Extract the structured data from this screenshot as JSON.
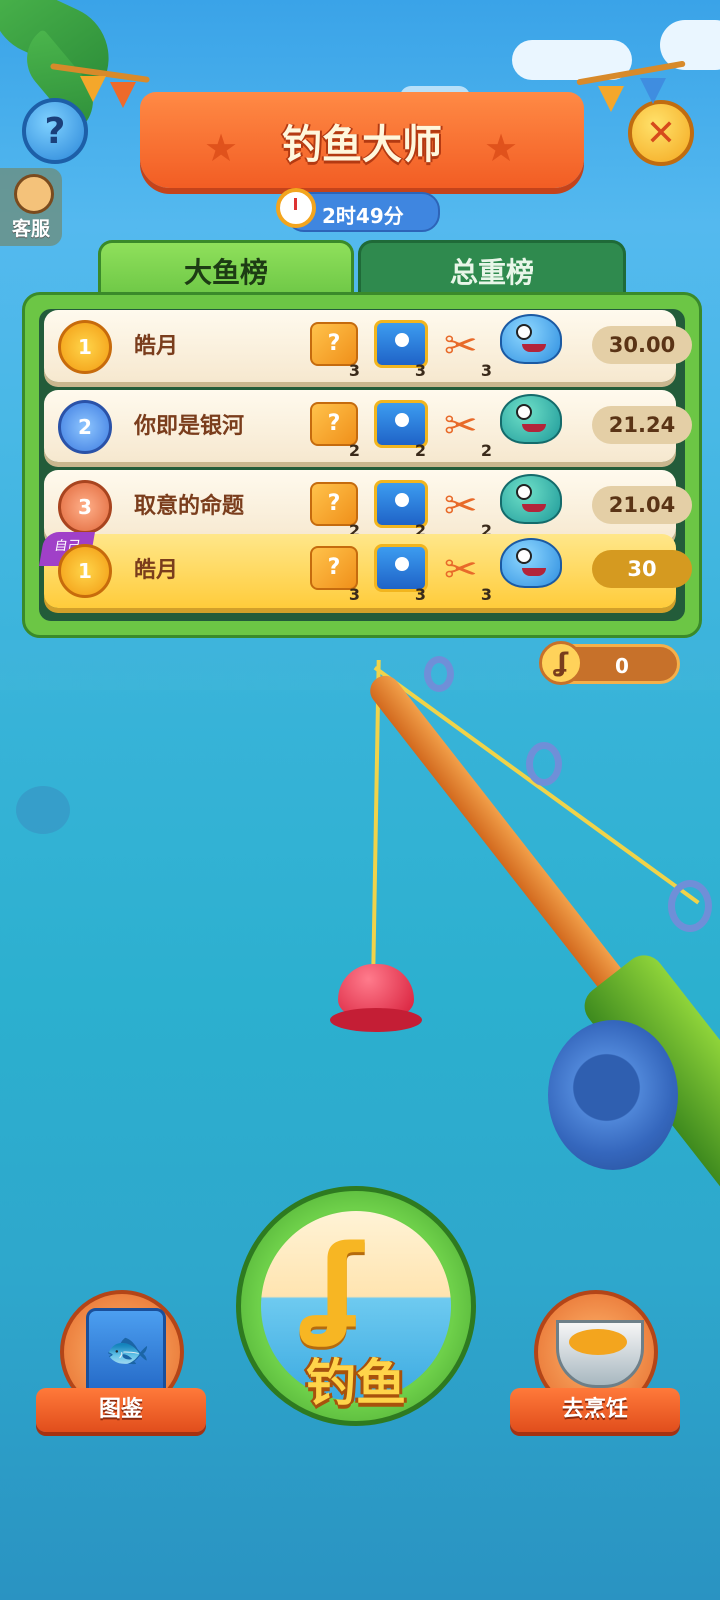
{
  "header": {
    "title": "钓鱼大师",
    "timer": "2时49分",
    "help_label": "?",
    "close_label": "✕",
    "service_label": "客服"
  },
  "tabs": [
    {
      "label": "大鱼榜",
      "active": true
    },
    {
      "label": "总重榜",
      "active": false
    }
  ],
  "leaderboard": [
    {
      "rank": "1",
      "medal": "gold",
      "name": "皓月",
      "box_count": "3",
      "chest_count": "3",
      "scissor_count": "3",
      "fish": "shark",
      "score": "30.00"
    },
    {
      "rank": "2",
      "medal": "silver",
      "name": "你即是银河",
      "box_count": "2",
      "chest_count": "2",
      "scissor_count": "2",
      "fish": "anglerfish",
      "score": "21.24"
    },
    {
      "rank": "3",
      "medal": "bronze",
      "name": "取意的命题",
      "box_count": "2",
      "chest_count": "2",
      "scissor_count": "2",
      "fish": "anglerfish",
      "score": "21.04"
    }
  ],
  "self_row": {
    "tag": "自己",
    "rank": "1",
    "medal": "gold",
    "name": "皓月",
    "box_count": "3",
    "chest_count": "3",
    "scissor_count": "3",
    "fish": "shark",
    "score": "30"
  },
  "hook_counter": {
    "icon": "hook-icon",
    "value": "0"
  },
  "bottom": {
    "catalog_label": "图鉴",
    "fish_label": "钓鱼",
    "cook_label": "去烹饪"
  },
  "colors": {
    "sea": "#2cb0cf",
    "board_green": "#6cc645",
    "banner_orange": "#f25d24"
  }
}
